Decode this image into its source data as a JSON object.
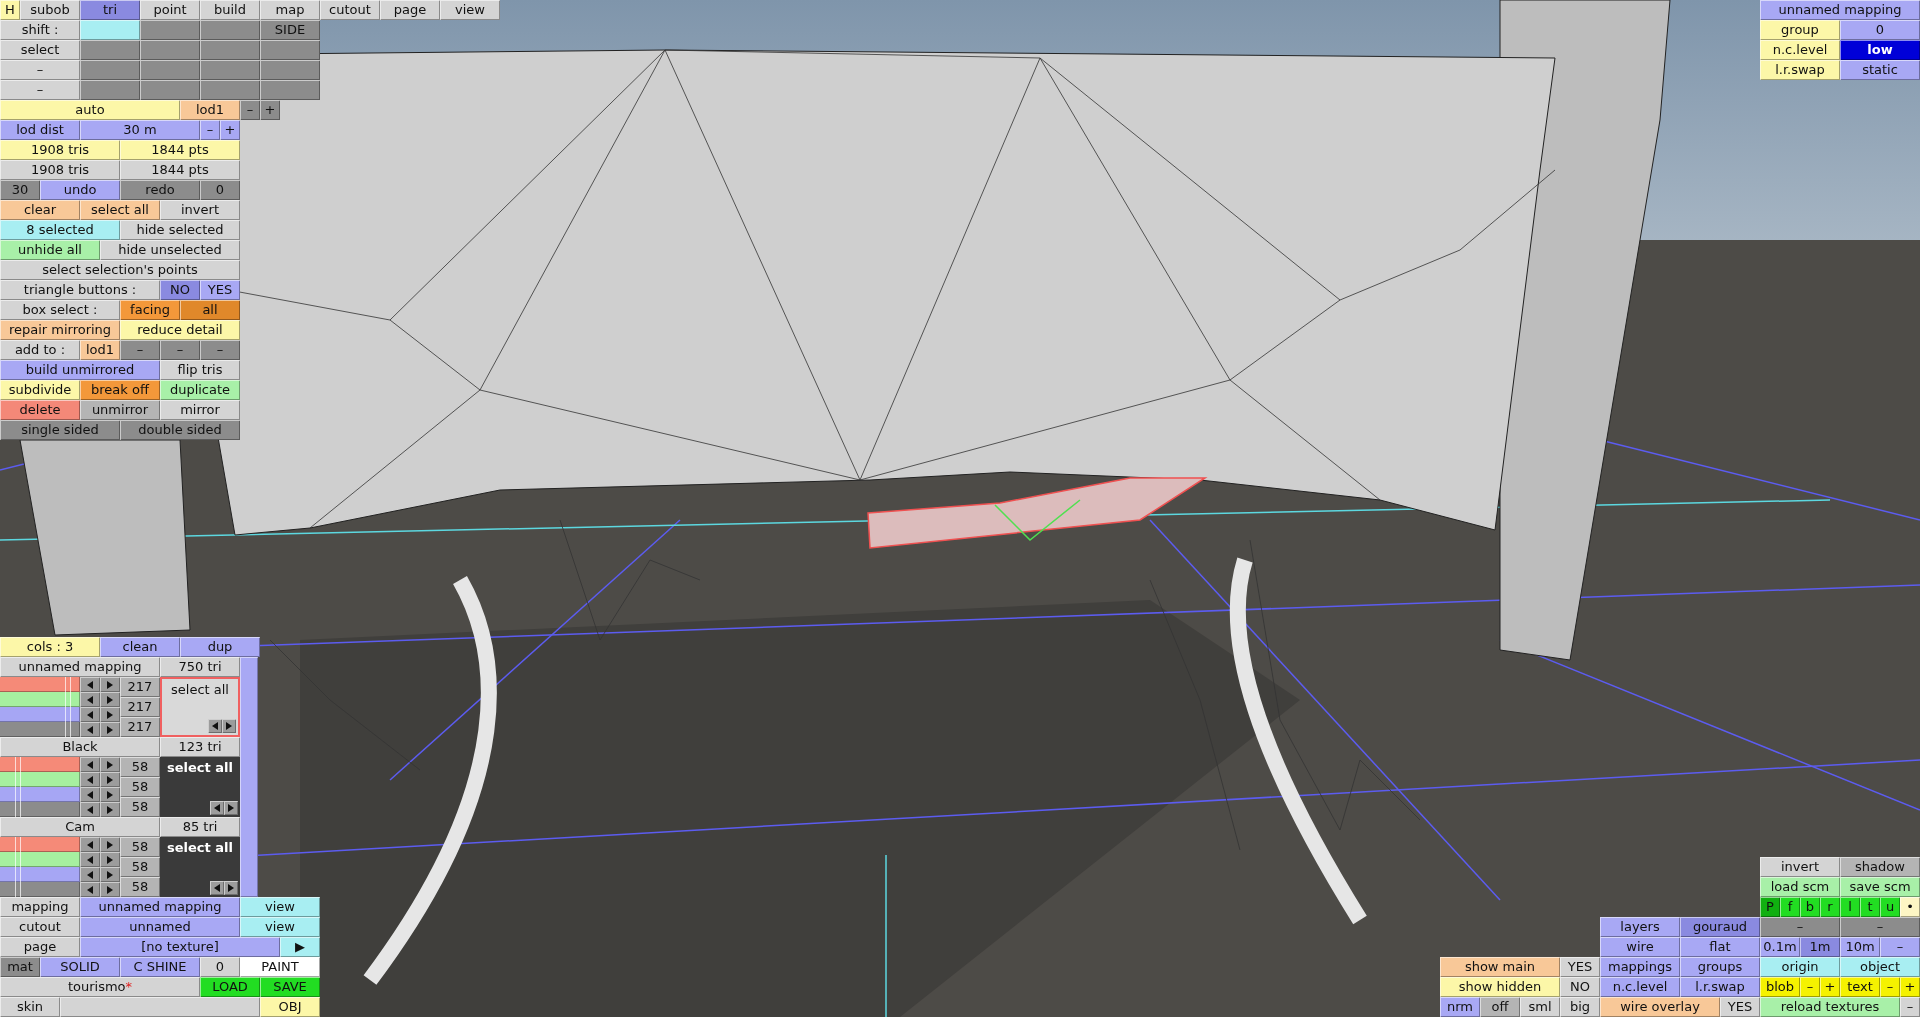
{
  "panels": [
    {
      "rows": [
        {
          "buttons": [
            {
              "text": "H",
              "kind": "yellow"
            },
            {
              "text": "subob",
              "kind": "plain"
            },
            {
              "text": "tri",
              "kind": "bluesel"
            },
            {
              "text": "point",
              "kind": "plain"
            },
            {
              "text": "build",
              "kind": "plain"
            },
            {
              "text": "map",
              "kind": "plain"
            },
            {
              "text": "cutout",
              "kind": "plain"
            },
            {
              "text": "page",
              "kind": "plain"
            },
            {
              "text": "view",
              "kind": "plain"
            }
          ]
        },
        {
          "buttons": [
            {
              "text": "shift :",
              "kind": "plain"
            },
            {
              "kind": "cyan"
            },
            {
              "kind": "dark"
            },
            {
              "kind": "dark"
            },
            {
              "text": "SIDE",
              "kind": "dark"
            }
          ]
        },
        {
          "buttons": [
            {
              "text": "select",
              "kind": "plain"
            },
            {
              "kind": "dark"
            },
            {
              "kind": "dark"
            },
            {
              "kind": "dark"
            },
            {
              "kind": "dark"
            }
          ]
        },
        {
          "buttons": [
            {
              "text": "–",
              "kind": "plain"
            },
            {
              "kind": "dark"
            },
            {
              "kind": "dark"
            },
            {
              "kind": "dark"
            },
            {
              "kind": "dark"
            }
          ]
        },
        {
          "buttons": [
            {
              "text": "–",
              "kind": "plain"
            },
            {
              "kind": "dark"
            },
            {
              "kind": "dark"
            },
            {
              "kind": "dark"
            },
            {
              "kind": "dark"
            }
          ]
        },
        {
          "buttons": [
            {
              "text": "auto",
              "kind": "yellow"
            },
            {
              "text": "lod1",
              "kind": "peach"
            },
            {
              "text": "–",
              "kind": "dark"
            },
            {
              "text": "+",
              "kind": "dark"
            }
          ]
        },
        {
          "buttons": [
            {
              "text": "lod dist",
              "kind": "blue"
            },
            {
              "text": "30 m",
              "kind": "blue"
            },
            {
              "text": "–",
              "kind": "blue"
            },
            {
              "text": "+",
              "kind": "blue"
            }
          ]
        },
        {
          "buttons": [
            {
              "text": "1908 tris",
              "kind": "yellow"
            },
            {
              "text": "1844 pts",
              "kind": "yellow"
            }
          ]
        },
        {
          "buttons": [
            {
              "text": "1908 tris",
              "kind": "plain"
            },
            {
              "text": "1844 pts",
              "kind": "plain"
            }
          ]
        },
        {
          "buttons": [
            {
              "text": "30",
              "kind": "dark"
            },
            {
              "text": "undo",
              "kind": "blue"
            },
            {
              "text": "redo",
              "kind": "dark"
            },
            {
              "text": "0",
              "kind": "dark"
            }
          ]
        },
        {
          "buttons": [
            {
              "text": "clear",
              "kind": "peach"
            },
            {
              "text": "select all",
              "kind": "peach"
            },
            {
              "text": "invert",
              "kind": "plain"
            }
          ]
        },
        {
          "buttons": [
            {
              "text": "8 selected",
              "kind": "cyan"
            },
            {
              "text": "hide selected",
              "kind": "plain"
            }
          ]
        },
        {
          "buttons": [
            {
              "text": "unhide all",
              "kind": "green"
            },
            {
              "text": "hide unselected",
              "kind": "plain"
            }
          ]
        },
        {
          "buttons": [
            {
              "text": "select selection's points",
              "kind": "plain"
            }
          ]
        },
        {
          "buttons": [
            {
              "text": "triangle buttons :",
              "kind": "plain"
            },
            {
              "text": "NO",
              "kind": "bluesel"
            },
            {
              "text": "YES",
              "kind": "blue"
            }
          ]
        },
        {
          "buttons": [
            {
              "text": "box select :",
              "kind": "plain"
            },
            {
              "text": "facing",
              "kind": "orange"
            },
            {
              "text": "all",
              "kind": "orangedark"
            }
          ]
        },
        {
          "buttons": [
            {
              "text": "repair mirroring",
              "kind": "peach"
            },
            {
              "text": "reduce detail",
              "kind": "yellow"
            }
          ]
        },
        {
          "buttons": [
            {
              "text": "add to :",
              "kind": "plain"
            },
            {
              "text": "lod1",
              "kind": "peach"
            },
            {
              "text": "–",
              "kind": "dark"
            },
            {
              "text": "–",
              "kind": "dark"
            },
            {
              "text": "–",
              "kind": "dark"
            }
          ]
        },
        {
          "buttons": [
            {
              "text": "build unmirrored",
              "kind": "blue"
            },
            {
              "text": "flip tris",
              "kind": "plain"
            }
          ]
        },
        {
          "buttons": [
            {
              "text": "subdivide",
              "kind": "yellow"
            },
            {
              "text": "break off",
              "kind": "orange"
            },
            {
              "text": "duplicate",
              "kind": "green"
            }
          ]
        },
        {
          "buttons": [
            {
              "text": "delete",
              "kind": "red"
            },
            {
              "text": "unmirror",
              "kind": "mid"
            },
            {
              "text": "mirror",
              "kind": "plain"
            }
          ]
        },
        {
          "buttons": [
            {
              "text": "single sided",
              "kind": "dark"
            },
            {
              "text": "double sided",
              "kind": "dark"
            }
          ]
        }
      ]
    },
    {
      "rows": [
        {
          "buttons": [
            {
              "text": "unnamed mapping",
              "kind": "blue"
            }
          ]
        },
        {
          "buttons": [
            {
              "text": "group",
              "kind": "yellow"
            },
            {
              "text": "0",
              "kind": "blue"
            }
          ]
        },
        {
          "buttons": [
            {
              "text": "n.c.level",
              "kind": "yellow"
            },
            {
              "text": "low",
              "kind": "navy"
            }
          ]
        },
        {
          "buttons": [
            {
              "text": "l.r.swap",
              "kind": "yellow"
            },
            {
              "text": "static",
              "kind": "blue"
            }
          ]
        }
      ]
    },
    {
      "rows": [
        {
          "buttons": [
            {
              "text": "show main",
              "kind": "peach"
            },
            {
              "text": "YES",
              "kind": "plain"
            }
          ]
        },
        {
          "buttons": [
            {
              "text": "show hidden",
              "kind": "yellow"
            },
            {
              "text": "NO",
              "kind": "plain"
            }
          ]
        },
        {
          "buttons": [
            {
              "text": "nrm",
              "kind": "blue"
            },
            {
              "text": "off",
              "kind": "mid"
            },
            {
              "text": "sml",
              "kind": "plain"
            },
            {
              "text": "big",
              "kind": "plain"
            }
          ]
        }
      ]
    },
    {
      "rows": [
        {
          "buttons": [
            {
              "text": "layers",
              "kind": "blue"
            },
            {
              "text": "gouraud",
              "kind": "bluesel"
            }
          ]
        },
        {
          "buttons": [
            {
              "text": "wire",
              "kind": "blue"
            },
            {
              "text": "flat",
              "kind": "blue"
            }
          ]
        },
        {
          "buttons": [
            {
              "text": "mappings",
              "kind": "blue"
            },
            {
              "text": "groups",
              "kind": "blue"
            }
          ]
        },
        {
          "buttons": [
            {
              "text": "n.c.level",
              "kind": "blue"
            },
            {
              "text": "l.r.swap",
              "kind": "blue"
            }
          ]
        },
        {
          "buttons": [
            {
              "text": "wire overlay",
              "kind": "peach"
            },
            {
              "text": "YES",
              "kind": "plain"
            }
          ]
        }
      ]
    },
    {
      "rows": [
        {
          "buttons": [
            {
              "text": "invert",
              "kind": "plain"
            },
            {
              "text": "shadow",
              "kind": "mid"
            }
          ]
        },
        {
          "buttons": [
            {
              "text": "load scm",
              "kind": "green"
            },
            {
              "text": "save scm",
              "kind": "green"
            }
          ]
        },
        {
          "buttons": [
            {
              "text": "P",
              "kind": "limesel"
            },
            {
              "text": "f",
              "kind": "lime"
            },
            {
              "text": "b",
              "kind": "lime"
            },
            {
              "text": "r",
              "kind": "lime"
            },
            {
              "text": "l",
              "kind": "lime"
            },
            {
              "text": "t",
              "kind": "lime"
            },
            {
              "text": "u",
              "kind": "lime"
            },
            {
              "text": "•",
              "kind": "cream"
            }
          ]
        },
        {
          "buttons": [
            {
              "text": "–",
              "kind": "dark"
            },
            {
              "text": "–",
              "kind": "dark"
            }
          ]
        },
        {
          "buttons": [
            {
              "text": "0.1m",
              "kind": "blue"
            },
            {
              "text": "1m",
              "kind": "bluesel"
            },
            {
              "text": "10m",
              "kind": "blue"
            },
            {
              "text": "–",
              "kind": "blue"
            }
          ]
        },
        {
          "buttons": [
            {
              "text": "origin",
              "kind": "cyan"
            },
            {
              "text": "object",
              "kind": "cyan"
            }
          ]
        },
        {
          "buttons": [
            {
              "text": "blob",
              "kind": "gold"
            },
            {
              "text": "–",
              "kind": "gold"
            },
            {
              "text": "+",
              "kind": "gold"
            },
            {
              "text": "text",
              "kind": "gold"
            },
            {
              "text": "–",
              "kind": "gold"
            },
            {
              "text": "+",
              "kind": "gold"
            }
          ]
        },
        {
          "buttons": [
            {
              "text": "reload textures",
              "kind": "green"
            },
            {
              "text": "–",
              "kind": "plain"
            }
          ]
        }
      ]
    }
  ],
  "color_panel": {
    "header": [
      {
        "text": "cols : 3",
        "kind": "yellow"
      },
      {
        "text": "clean",
        "kind": "blue"
      },
      {
        "text": "dup",
        "kind": "blue"
      }
    ],
    "materials": [
      {
        "name": "unnamed mapping",
        "tris": "750 tri",
        "selected": true,
        "channels": [
          {
            "level": 0.85
          },
          {
            "level": 0.85
          },
          {
            "level": 0.85
          },
          {
            "level": 0.85
          }
        ],
        "values": [
          "217",
          "217",
          "217"
        ],
        "action": "select all"
      },
      {
        "name": "Black",
        "tris": "123 tri",
        "selected": false,
        "channels": [
          {
            "level": 0.23
          },
          {
            "level": 0.23
          },
          {
            "level": 0.23
          },
          {
            "level": 0.23
          }
        ],
        "values": [
          "58",
          "58",
          "58"
        ],
        "action": "select all"
      },
      {
        "name": "Cam",
        "tris": "85 tri",
        "selected": false,
        "channels": [
          {
            "level": 0.23
          },
          {
            "level": 0.23
          },
          {
            "level": 0.23
          },
          {
            "level": 0.23
          }
        ],
        "values": [
          "58",
          "58",
          "58"
        ],
        "action": "select all"
      }
    ],
    "rows": [
      {
        "buttons": [
          {
            "text": "mapping",
            "kind": "plain"
          },
          {
            "text": "unnamed mapping",
            "kind": "blue"
          },
          {
            "text": "view",
            "kind": "cyan"
          }
        ]
      },
      {
        "buttons": [
          {
            "text": "cutout",
            "kind": "plain"
          },
          {
            "text": "unnamed",
            "kind": "blue"
          },
          {
            "text": "view",
            "kind": "cyan"
          }
        ]
      },
      {
        "buttons": [
          {
            "text": "page",
            "kind": "plain"
          },
          {
            "text": "[no texture]",
            "kind": "blue"
          },
          {
            "text": "▶",
            "kind": "cyan"
          }
        ]
      },
      {
        "buttons": [
          {
            "text": "mat",
            "kind": "dark"
          },
          {
            "text": "SOLID",
            "kind": "blue"
          },
          {
            "text": "C SHINE",
            "kind": "blue"
          },
          {
            "text": "0",
            "kind": "plain"
          },
          {
            "text": "PAINT",
            "kind": "white"
          }
        ]
      },
      {
        "buttons": [
          {
            "text": "tourismo",
            "suffix": "*",
            "kind": "plain"
          },
          {
            "text": "LOAD",
            "kind": "lime"
          },
          {
            "text": "SAVE",
            "kind": "lime"
          }
        ]
      },
      {
        "buttons": [
          {
            "text": "skin",
            "kind": "plain"
          },
          {
            "kind": "plain"
          },
          {
            "text": "OBJ",
            "kind": "yellow"
          }
        ]
      }
    ]
  }
}
